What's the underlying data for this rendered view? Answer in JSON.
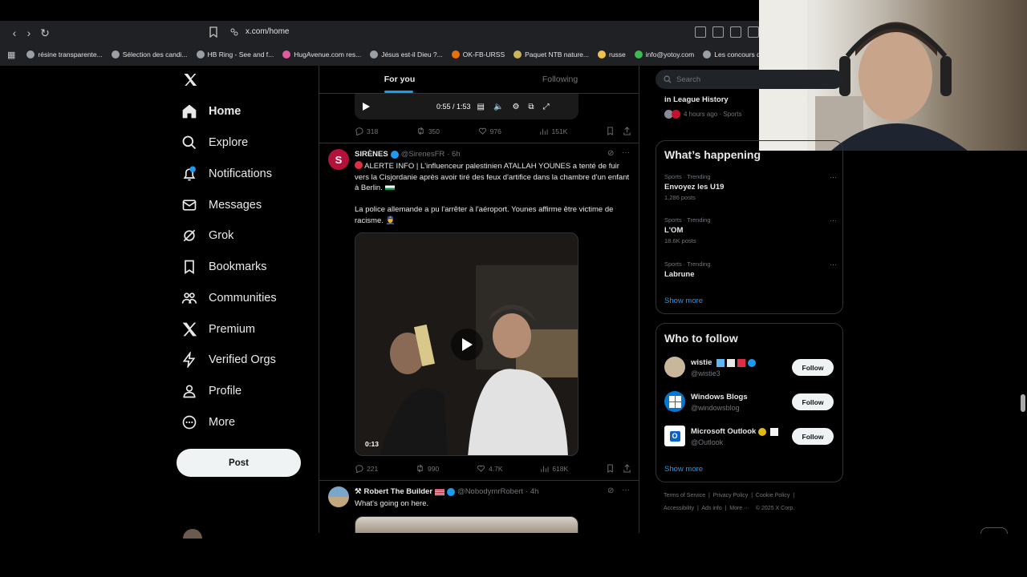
{
  "browser": {
    "url": "x.com/home",
    "bookmarks": [
      {
        "label": "résine transparente...",
        "icon": "globe-icon",
        "color": "#9aa0a6"
      },
      {
        "label": "Sélection des candi...",
        "icon": "doc-icon",
        "color": "#9aa0a6"
      },
      {
        "label": "HB Ring - See and f...",
        "icon": "globe-icon",
        "color": "#9aa0a6"
      },
      {
        "label": "HugAvenue.com res...",
        "icon": "heart-icon",
        "color": "#e05aa0"
      },
      {
        "label": "Jésus est-il Dieu ?...",
        "icon": "globe-icon",
        "color": "#9aa0a6"
      },
      {
        "label": "OK-FB-URSS",
        "icon": "square-icon",
        "color": "#e8710a"
      },
      {
        "label": "Paquet NTB nature...",
        "icon": "leaf-icon",
        "color": "#c9b35d"
      },
      {
        "label": "russe",
        "icon": "folder-icon",
        "color": "#f0c24b"
      },
      {
        "label": "info@yotoy.com",
        "icon": "shield-icon",
        "color": "#3cba54"
      },
      {
        "label": "Les concours d'aute...",
        "icon": "doc-icon",
        "color": "#9aa0a6"
      }
    ]
  },
  "sidebar": {
    "items": [
      {
        "label": "Home",
        "icon": "home-icon"
      },
      {
        "label": "Explore",
        "icon": "search-icon"
      },
      {
        "label": "Notifications",
        "icon": "bell-icon",
        "badge": "2"
      },
      {
        "label": "Messages",
        "icon": "mail-icon"
      },
      {
        "label": "Grok",
        "icon": "grok-icon"
      },
      {
        "label": "Bookmarks",
        "icon": "bookmark-icon"
      },
      {
        "label": "Communities",
        "icon": "communities-icon"
      },
      {
        "label": "Premium",
        "icon": "x-logo-icon"
      },
      {
        "label": "Verified Orgs",
        "icon": "lightning-icon"
      },
      {
        "label": "Profile",
        "icon": "person-icon"
      },
      {
        "label": "More",
        "icon": "more-circle-icon"
      }
    ],
    "post_label": "Post"
  },
  "feed": {
    "tabs": [
      {
        "label": "For you"
      },
      {
        "label": "Following"
      }
    ],
    "top_video": {
      "time": "0:55 / 1:53"
    },
    "top_actions": {
      "replies": "318",
      "reposts": "350",
      "likes": "976",
      "views": "151K"
    },
    "tweet1": {
      "name": "SIRÈNES",
      "handle": "@SirenesFR",
      "time": "· 6h",
      "text1": "ALERTE INFO | L'influenceur palestinien ATALLAH YOUNES a tenté de fuir vers la Cisjordanie après avoir tiré des feux d'artifice dans la chambre d'un enfant à Berlin.",
      "text2": "La police allemande a pu l'arrêter à l'aéroport. Younes affirme être victime de racisme.",
      "video_time": "0:13",
      "actions": {
        "replies": "221",
        "reposts": "990",
        "likes": "4.7K",
        "views": "618K"
      }
    },
    "tweet2": {
      "name": "Robert The Builder",
      "handle": "@NobodymrRobert",
      "time": "· 4h",
      "text": "What's going on here."
    }
  },
  "right": {
    "search_placeholder": "Search",
    "top_snippet": {
      "title": "in League History",
      "meta": "4 hours ago · Sports"
    },
    "happening": {
      "title": "What’s happening",
      "trends": [
        {
          "meta": "Sports · Trending",
          "name": "Envoyez les U19",
          "posts": "1,286 posts"
        },
        {
          "meta": "Sports · Trending",
          "name": "L'OM",
          "posts": "18.6K posts"
        },
        {
          "meta": "Sports · Trending",
          "name": "Labrune",
          "posts": ""
        }
      ],
      "show_more": "Show more"
    },
    "who_to_follow": {
      "title": "Who to follow",
      "users": [
        {
          "name": "wistie",
          "handle": "@wistie3",
          "follow": "Follow"
        },
        {
          "name": "Windows Blogs",
          "handle": "@windowsblog",
          "follow": "Follow"
        },
        {
          "name": "Microsoft Outlook",
          "handle": "@Outlook",
          "follow": "Follow"
        }
      ],
      "show_more": "Show more"
    },
    "footer": {
      "line1": [
        "Terms of Service",
        "Privacy Policy",
        "Cookie Policy"
      ],
      "line2": [
        "Accessibility",
        "Ads info",
        "More ···",
        "© 2025 X Corp."
      ]
    }
  },
  "colors": {
    "accent": "#1d9bf0",
    "background": "#000000",
    "border": "#2f3336",
    "muted": "#71767b"
  }
}
